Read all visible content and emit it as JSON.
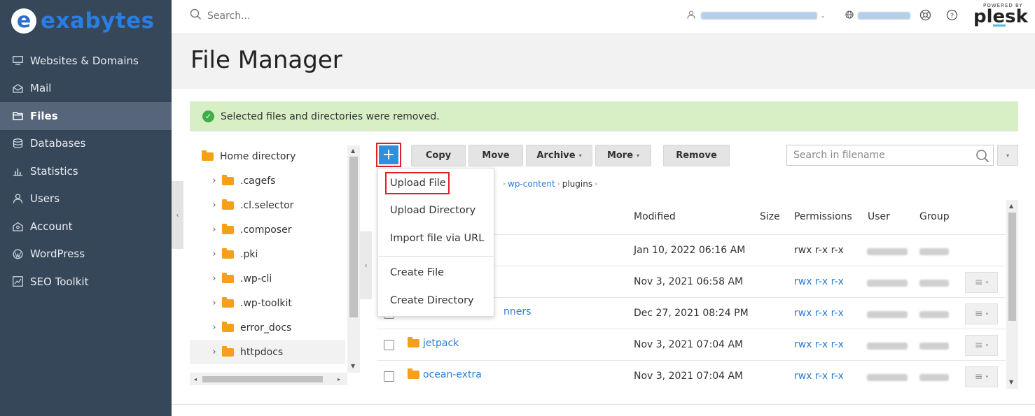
{
  "brand": {
    "logo_letter": "e",
    "logo_text": "exabytes"
  },
  "sidebar": {
    "items": [
      {
        "label": "Websites & Domains",
        "icon": "monitor-icon"
      },
      {
        "label": "Mail",
        "icon": "mail-icon"
      },
      {
        "label": "Files",
        "icon": "folder-icon",
        "active": true
      },
      {
        "label": "Databases",
        "icon": "database-icon"
      },
      {
        "label": "Statistics",
        "icon": "bar-chart-icon"
      },
      {
        "label": "Users",
        "icon": "user-icon"
      },
      {
        "label": "Account",
        "icon": "account-icon"
      },
      {
        "label": "WordPress",
        "icon": "wordpress-icon"
      },
      {
        "label": "SEO Toolkit",
        "icon": "seo-chart-icon"
      }
    ]
  },
  "header": {
    "search_placeholder": "Search...",
    "powered_by": "POWERED BY",
    "plesk": "plesk"
  },
  "page": {
    "title": "File Manager"
  },
  "alert": {
    "message": "Selected files and directories were removed."
  },
  "tree": {
    "items": [
      {
        "label": "Home directory",
        "root": true
      },
      {
        "label": ".cagefs"
      },
      {
        "label": ".cl.selector"
      },
      {
        "label": ".composer"
      },
      {
        "label": ".pki"
      },
      {
        "label": ".wp-cli"
      },
      {
        "label": ".wp-toolkit"
      },
      {
        "label": "error_docs"
      },
      {
        "label": "httpdocs",
        "selected": true
      }
    ]
  },
  "toolbar": {
    "add": "+",
    "copy": "Copy",
    "move": "Move",
    "archive": "Archive",
    "more": "More",
    "remove": "Remove",
    "search_placeholder": "Search in filename"
  },
  "breadcrumb": [
    {
      "label": "wp-content",
      "link": true
    },
    {
      "label": "plugins",
      "link": false
    }
  ],
  "table": {
    "headers": {
      "modified": "Modified",
      "size": "Size",
      "permissions": "Permissions",
      "user": "User",
      "group": "Group"
    },
    "rows": [
      {
        "name": "",
        "modified": "Jan 10, 2022 06:16 AM",
        "permissions": "rwx r-x r-x",
        "perm_link": false,
        "menu": false
      },
      {
        "name": "",
        "modified": "Nov 3, 2021 06:58 AM",
        "permissions": "rwx r-x r-x",
        "perm_link": true,
        "menu": true
      },
      {
        "name": "nners",
        "modified": "Dec 27, 2021 08:24 PM",
        "permissions": "rwx r-x r-x",
        "perm_link": true,
        "menu": true
      },
      {
        "name": "jetpack",
        "modified": "Nov 3, 2021 07:04 AM",
        "permissions": "rwx r-x r-x",
        "perm_link": true,
        "menu": true
      },
      {
        "name": "ocean-extra",
        "modified": "Nov 3, 2021 07:04 AM",
        "permissions": "rwx r-x r-x",
        "perm_link": true,
        "menu": true
      }
    ]
  },
  "dropdown": {
    "items": [
      "Upload File",
      "Upload Directory",
      "Import file via URL",
      "Create File",
      "Create Directory"
    ]
  },
  "colors": {
    "sidebar": "#37475a",
    "accent": "#2f8fdc",
    "highlight": "#e2202b",
    "alert_bg": "#d8efc6",
    "folder": "#f6a01a"
  }
}
